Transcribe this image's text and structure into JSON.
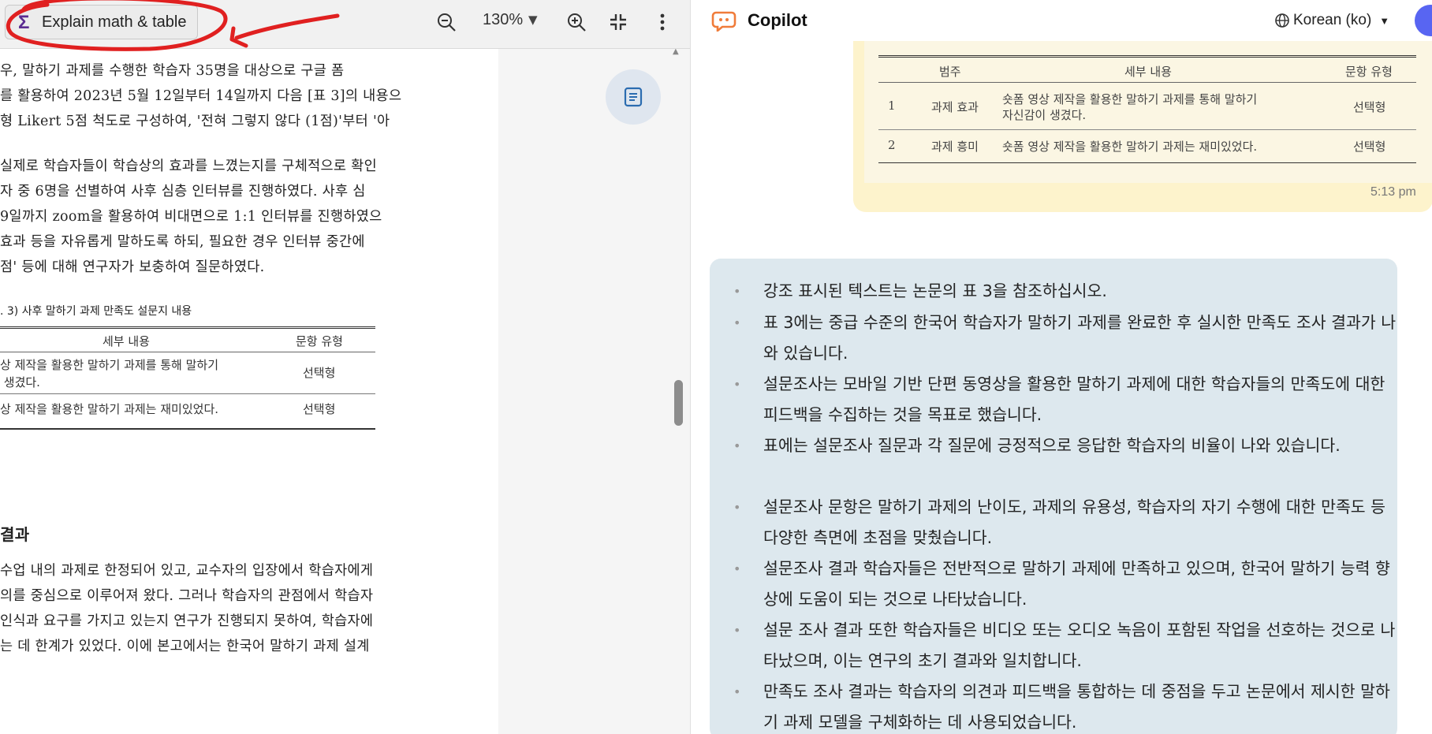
{
  "toolbar": {
    "explain_label": "Explain math & table",
    "zoom_level": "130%"
  },
  "pdf": {
    "lines_top": [
      "우, 말하기 과제를 수행한 학습자 35명을 대상으로 구글 폼",
      "를 활용하여 2023년 5월 12일부터 14일까지 다음 [표 3]의 내용으",
      "형 Likert 5점 척도로 구성하여, '전혀 그렇지 않다 (1점)'부터 '아"
    ],
    "lines_mid": [
      "실제로 학습자들이 학습상의 효과를 느꼈는지를 구체적으로 확인",
      "자 중 6명을 선별하여 사후 심층 인터뷰를 진행하였다. 사후 심",
      "9일까지 zoom을 활용하여 비대면으로 1:1 인터뷰를 진행하였으",
      "효과 등을 자유롭게 말하도록 하되, 필요한 경우 인터뷰 중간에",
      "점' 등에 대해 연구자가 보충하여 질문하였다."
    ],
    "table_caption": ". 3) 사후 말하기 과제 만족도 설문지 내용",
    "table": {
      "headers": [
        "세부 내용",
        "문항 유형"
      ],
      "rows": [
        {
          "content_line1": "상 제작을 활용한 말하기 과제를 통해 말하기",
          "content_line2": " 생겼다.",
          "type": "선택형"
        },
        {
          "content_line1": "상 제작을 활용한 말하기 과제는 재미있었다.",
          "content_line2": "",
          "type": "선택형"
        }
      ]
    },
    "section_heading": "결과",
    "lines_bottom": [
      "수업 내의 과제로 한정되어 있고, 교수자의 입장에서 학습자에게",
      "의를 중심으로 이루어져 왔다. 그러나 학습자의 관점에서 학습자",
      "인식과 요구를 가지고 있는지 연구가 진행되지 못하여, 학습자에",
      "는 데 한계가 있었다. 이에 본고에서는 한국어 말하기 과제 설계"
    ]
  },
  "copilot": {
    "title": "Copilot",
    "language": "Korean (ko)",
    "user_table": {
      "headers": [
        "범주",
        "세부 내용",
        "문항 유형"
      ],
      "rows": [
        {
          "num": "1",
          "cat": "과제 효과",
          "line1": "숏폼 영상 제작을 활용한 말하기 과제를 통해 말하기",
          "line2": "자신감이 생겼다.",
          "type": "선택형"
        },
        {
          "num": "2",
          "cat": "과제 흥미",
          "line1": "숏폼 영상 제작을 활용한 말하기 과제는 재미있었다.",
          "line2": "",
          "type": "선택형"
        }
      ]
    },
    "message_time": "5:13 pm",
    "bullets": [
      "강조 표시된 텍스트는 논문의 표 3을 참조하십시오.",
      "표 3에는 중급 수준의 한국어 학습자가 말하기 과제를 완료한 후 실시한 만족도 조사 결과가 나와 있습니다.",
      "설문조사는 모바일 기반 단편 동영상을 활용한 말하기 과제에 대한 학습자들의 만족도에 대한 피드백을 수집하는 것을 목표로 했습니다.",
      "표에는 설문조사 질문과 각 질문에 긍정적으로 응답한 학습자의 비율이 나와 있습니다.",
      "설문조사 문항은 말하기 과제의 난이도, 과제의 유용성, 학습자의 자기 수행에 대한 만족도 등 다양한 측면에 초점을 맞췄습니다.",
      "설문조사 결과 학습자들은 전반적으로 말하기 과제에 만족하고 있으며, 한국어 말하기 능력 향상에 도움이 되는 것으로 나타났습니다.",
      "설문 조사 결과 또한 학습자들은 비디오 또는 오디오 녹음이 포함된 작업을 선호하는 것으로 나타났으며, 이는 연구의 초기 결과와 일치합니다.",
      "만족도 조사 결과는 학습자의 의견과 피드백을 통합하는 데 중점을 두고 논문에서 제시한 말하기 과제 모델을 구체화하는 데 사용되었습니다."
    ]
  },
  "colors": {
    "annotation_red": "#e02020",
    "bot_bubble": "#dde8ee",
    "user_bubble": "#fdf3cc",
    "copilot_orange": "#f07c3a"
  }
}
